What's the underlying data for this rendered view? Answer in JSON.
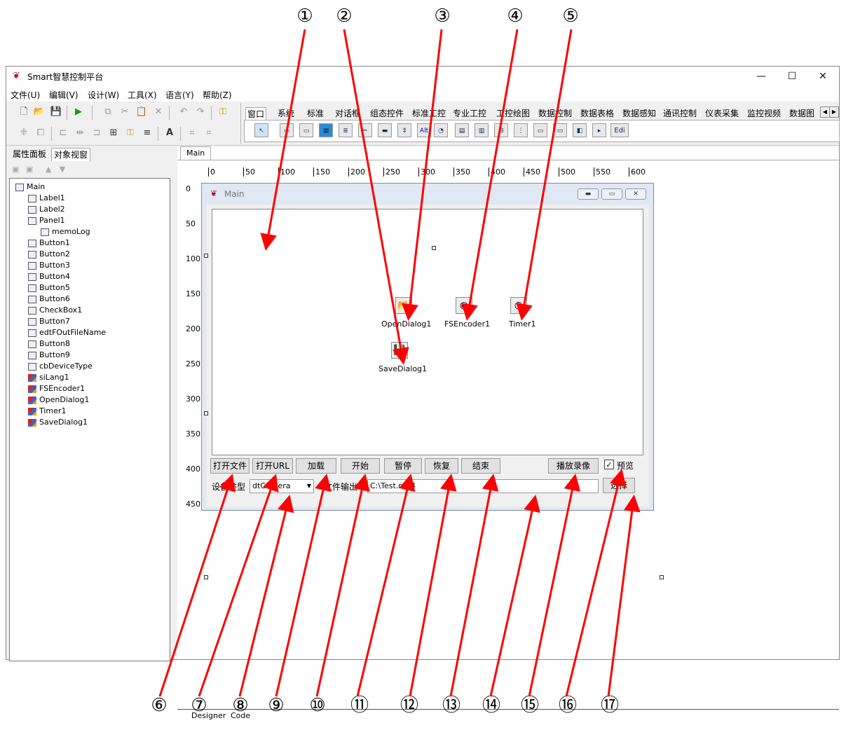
{
  "window": {
    "title": "Smart智慧控制平台",
    "min_glyph": "—",
    "max_glyph": "☐",
    "close_glyph": "✕"
  },
  "menu": [
    "文件(U)",
    "编辑(V)",
    "设计(W)",
    "工具(X)",
    "语言(Y)",
    "帮助(Z)"
  ],
  "palette_tabs": [
    "窗口",
    "系统",
    "标准",
    "对话框",
    "组态控件",
    "标准工控",
    "专业工控",
    "工控绘图",
    "数据控制",
    "数据表格",
    "数据感知",
    "通讯控制",
    "仪表采集",
    "监控视频",
    "数据图"
  ],
  "palette_edit_label": "Edi",
  "left_tabs": [
    "属性面板",
    "对象视窗"
  ],
  "tree": [
    {
      "label": "Main",
      "level": 0,
      "icon": "form"
    },
    {
      "label": "Label1",
      "level": 1,
      "icon": "control"
    },
    {
      "label": "Label2",
      "level": 1,
      "icon": "control"
    },
    {
      "label": "Panel1",
      "level": 1,
      "icon": "control"
    },
    {
      "label": "memoLog",
      "level": 2,
      "icon": "control"
    },
    {
      "label": "Button1",
      "level": 1,
      "icon": "control"
    },
    {
      "label": "Button2",
      "level": 1,
      "icon": "control"
    },
    {
      "label": "Button3",
      "level": 1,
      "icon": "control"
    },
    {
      "label": "Button4",
      "level": 1,
      "icon": "control"
    },
    {
      "label": "Button5",
      "level": 1,
      "icon": "control"
    },
    {
      "label": "Button6",
      "level": 1,
      "icon": "control"
    },
    {
      "label": "CheckBox1",
      "level": 1,
      "icon": "control"
    },
    {
      "label": "Button7",
      "level": 1,
      "icon": "control"
    },
    {
      "label": "edtFOutFileName",
      "level": 1,
      "icon": "control"
    },
    {
      "label": "Button8",
      "level": 1,
      "icon": "control"
    },
    {
      "label": "Button9",
      "level": 1,
      "icon": "control"
    },
    {
      "label": "cbDeviceType",
      "level": 1,
      "icon": "control"
    },
    {
      "label": "siLang1",
      "level": 1,
      "icon": "component"
    },
    {
      "label": "FSEncoder1",
      "level": 1,
      "icon": "component"
    },
    {
      "label": "OpenDialog1",
      "level": 1,
      "icon": "component"
    },
    {
      "label": "Timer1",
      "level": 1,
      "icon": "component"
    },
    {
      "label": "SaveDialog1",
      "level": 1,
      "icon": "component"
    }
  ],
  "designer": {
    "tab": "Main",
    "ruler_top": [
      "0",
      "50",
      "100",
      "150",
      "200",
      "250",
      "300",
      "350",
      "400",
      "450",
      "500",
      "550",
      "600"
    ],
    "ruler_left": [
      "0",
      "50",
      "100",
      "150",
      "200",
      "250",
      "300",
      "350",
      "400",
      "450"
    ],
    "bottom_tabs": [
      "Designer",
      "Code"
    ]
  },
  "form": {
    "caption": "Main",
    "components": {
      "open_dialog": "OpenDialog1",
      "fs_encoder": "FSEncoder1",
      "timer": "Timer1",
      "save_dialog": "SaveDialog1"
    },
    "buttons": {
      "open_file": "打开文件",
      "open_url": "打开URL",
      "load": "加载",
      "start": "开始",
      "pause": "暂停",
      "resume": "恢复",
      "stop": "结束",
      "play_record": "播放录像",
      "select": "选择"
    },
    "preview_label": "预览",
    "device_type_label": "设备类型",
    "device_type_value": "dtCamera",
    "file_output_label": "文件输出",
    "file_output_value": "C:\\Test.mp4"
  },
  "callouts": [
    "①",
    "②",
    "③",
    "④",
    "⑤",
    "⑥",
    "⑦",
    "⑧",
    "⑨",
    "⑩",
    "⑪",
    "⑫",
    "⑬",
    "⑭",
    "⑮",
    "⑯",
    "⑰"
  ],
  "colors": {
    "arrow": "#ff0000"
  }
}
